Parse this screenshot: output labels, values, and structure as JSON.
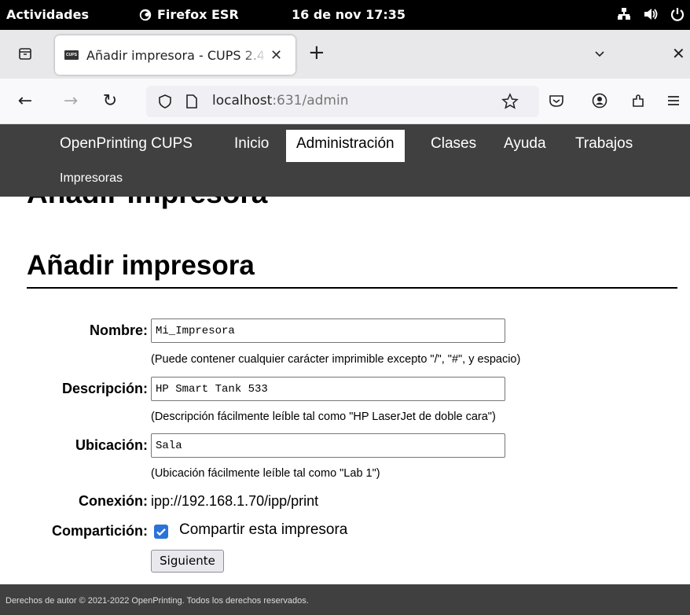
{
  "topbar": {
    "activities": "Actividades",
    "app_name": "Firefox ESR",
    "clock": "16 de nov  17:35",
    "icons": [
      "network-icon",
      "volume-icon",
      "power-icon"
    ]
  },
  "browser": {
    "tab_title": "Añadir impresora - CUPS 2.4",
    "favicon_text": "CUPS",
    "url_host": "localhost",
    "url_rest": ":631/admin"
  },
  "cups_nav": {
    "items": [
      "OpenPrinting CUPS",
      "Inicio",
      "Administración",
      "Clases",
      "Ayuda",
      "Trabajos",
      "Impresoras"
    ],
    "active": "Administración"
  },
  "page": {
    "ghost_title": "Añadir impresora",
    "heading": "Añadir impresora"
  },
  "form": {
    "name_label": "Nombre:",
    "name_value": "Mi_Impresora",
    "name_hint": "(Puede contener cualquier carácter imprimible excepto \"/\", \"#\", y espacio)",
    "desc_label": "Descripción:",
    "desc_value": "HP Smart Tank 533",
    "desc_hint": "(Descripción fácilmente leíble tal como \"HP LaserJet de doble cara\")",
    "loc_label": "Ubicación:",
    "loc_value": "Sala",
    "loc_hint": "(Ubicación fácilmente leíble tal como \"Lab 1\")",
    "conn_label": "Conexión:",
    "conn_value": "ipp://192.168.1.70/ipp/print",
    "share_label": "Compartición:",
    "share_checkbox_label": "Compartir esta impresora",
    "share_checked": true,
    "next_button": "Siguiente"
  },
  "footer": {
    "text": "Derechos de autor © 2021-2022 OpenPrinting. Todos los derechos reservados."
  },
  "colors": {
    "cups_header": "#404040",
    "checkbox": "#2a73d8",
    "topbar": "#000000"
  }
}
